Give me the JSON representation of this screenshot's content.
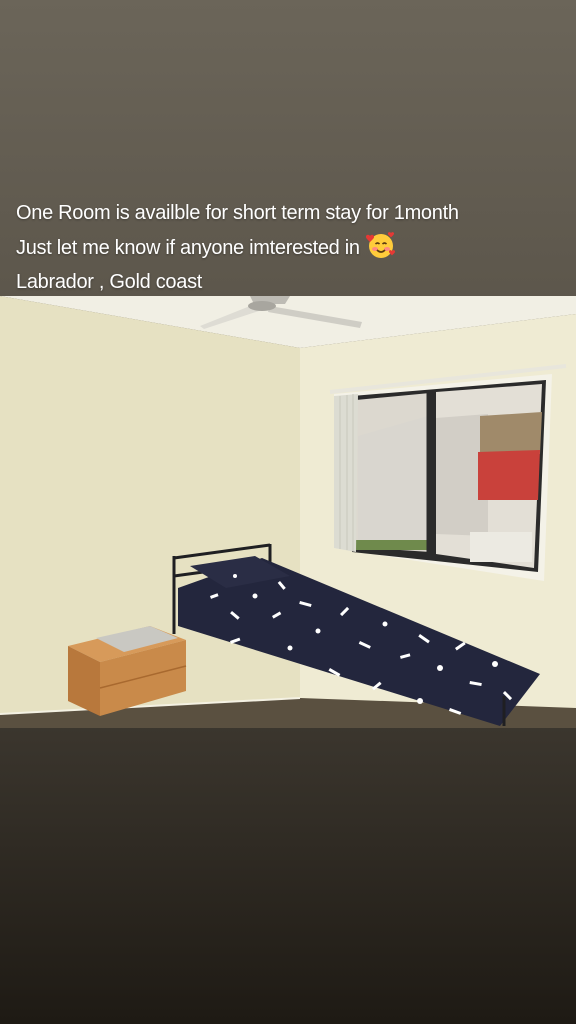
{
  "story": {
    "caption_lines": [
      "One Room is availble for short term stay for 1month",
      "Just let me know if anyone imterested in",
      "Labrador , Gold coast"
    ],
    "emoji": "smiling-face-with-hearts-icon"
  },
  "photo": {
    "subject": "bedroom-photo",
    "colors": {
      "wall": "#e9e5c9",
      "ceiling": "#f3f1e6",
      "floor": "#5a5040",
      "bedspread": "#23263d",
      "pattern": "#ffffff",
      "nightstand": "#c98a4a",
      "window_frame": "#2b2b2b",
      "curtain": "#dcdcd2",
      "awning": "#c9413b"
    }
  }
}
